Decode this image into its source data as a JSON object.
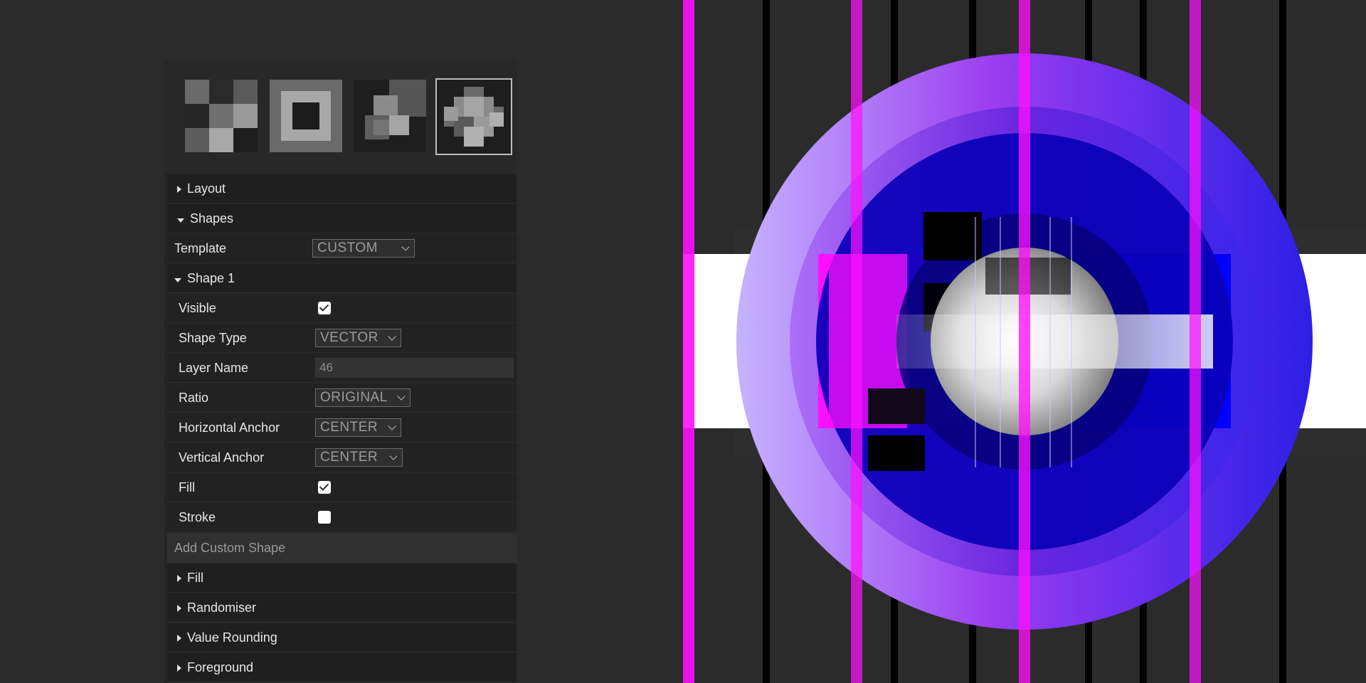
{
  "presets": [
    {
      "name": "checker-pattern-preset",
      "selected": false
    },
    {
      "name": "frame-pattern-preset",
      "selected": false
    },
    {
      "name": "stacked-squares-preset",
      "selected": false
    },
    {
      "name": "cross-cluster-preset",
      "selected": true
    }
  ],
  "sections": {
    "layout": "Layout",
    "shapes": "Shapes",
    "fill": "Fill",
    "randomiser": "Randomiser",
    "value_rounding": "Value Rounding",
    "foreground": "Foreground"
  },
  "template": {
    "label": "Template",
    "value": "CUSTOM"
  },
  "shape1": {
    "title": "Shape 1",
    "visible": {
      "label": "Visible",
      "checked": true
    },
    "shape_type": {
      "label": "Shape Type",
      "value": "VECTOR"
    },
    "layer_name": {
      "label": "Layer Name",
      "value": "46"
    },
    "ratio": {
      "label": "Ratio",
      "value": "ORIGINAL"
    },
    "h_anchor": {
      "label": "Horizontal Anchor",
      "value": "CENTER"
    },
    "v_anchor": {
      "label": "Vertical Anchor",
      "value": "CENTER"
    },
    "fill": {
      "label": "Fill",
      "checked": true
    },
    "stroke": {
      "label": "Stroke",
      "checked": false
    }
  },
  "add_custom_shape": "Add Custom Shape",
  "colors": {
    "magenta": "#ff10ff",
    "blue": "#0000ff",
    "deep_blue": "#0a00b8",
    "violet": "#8a2be2",
    "lavender": "#c2b0ff",
    "white": "#ffffff"
  }
}
